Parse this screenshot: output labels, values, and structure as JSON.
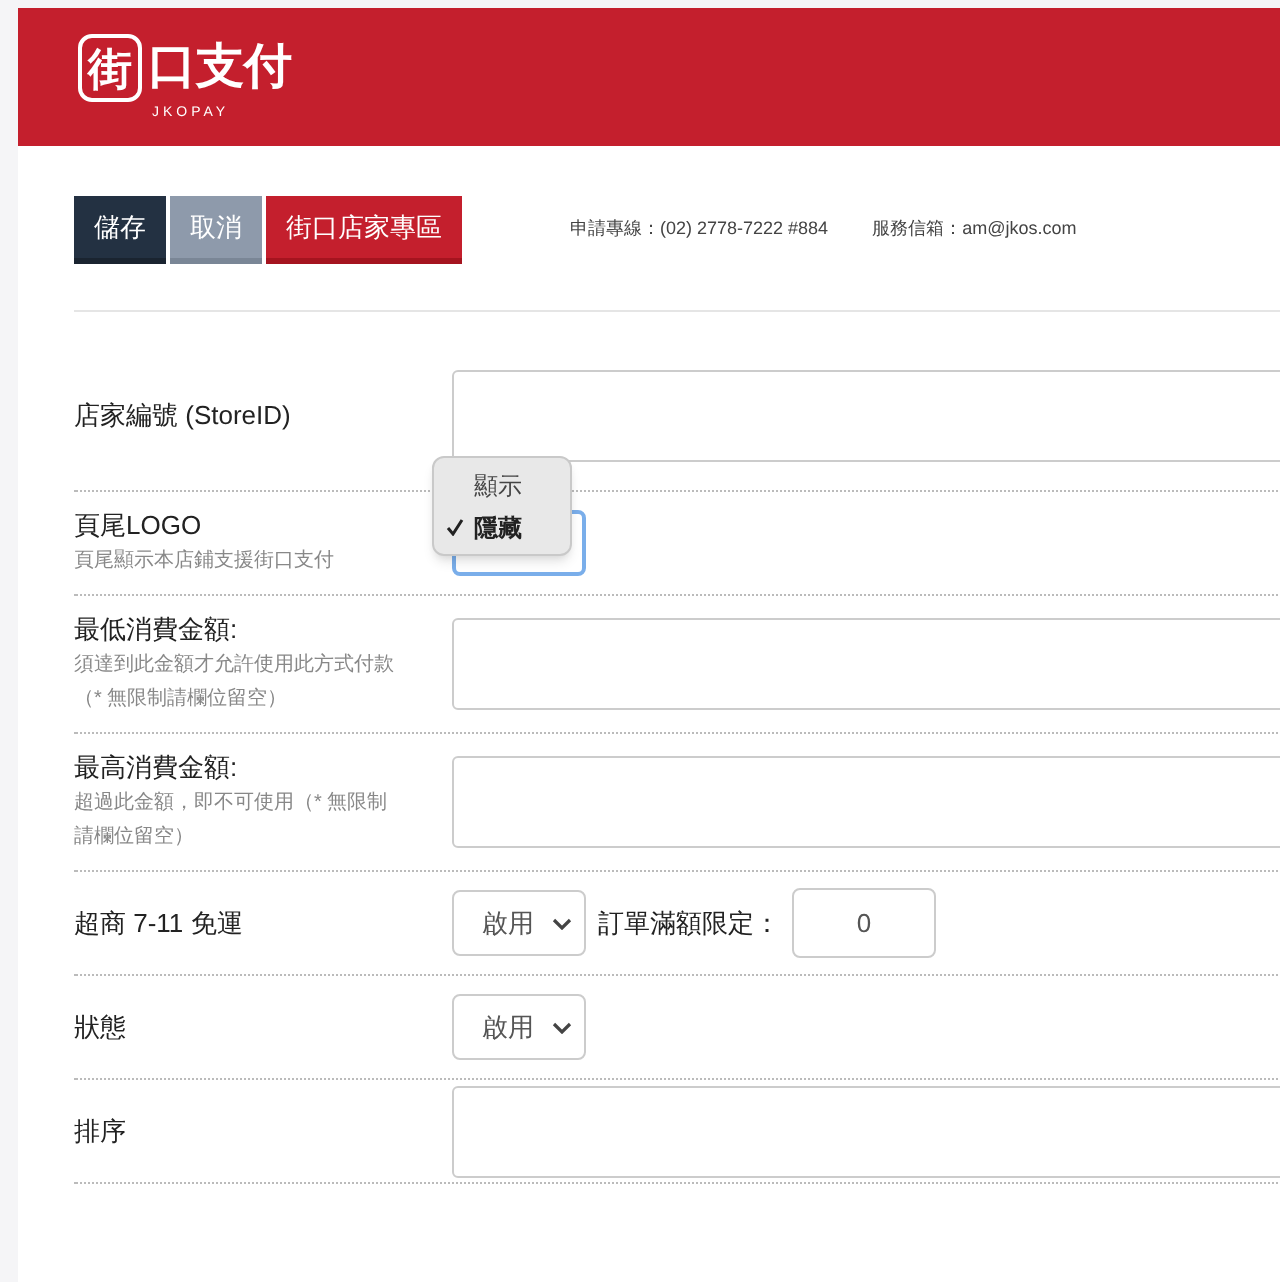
{
  "header": {
    "logo_mark": "街",
    "logo_text": "口支付",
    "logo_subtitle": "JKOPAY"
  },
  "toolbar": {
    "buttons": [
      {
        "label": "儲存",
        "kind": "save"
      },
      {
        "label": "取消",
        "kind": "cancel"
      },
      {
        "label": "街口店家專區",
        "kind": "brand"
      }
    ],
    "contact_phone": "申請專線：(02) 2778-7222 #884",
    "contact_email": "服務信箱：am@jkos.com"
  },
  "form": [
    {
      "kind": "input",
      "label": "店家編號 (StoreID)"
    },
    {
      "kind": "menu",
      "label": "頁尾LOGO",
      "hints": [
        "頁尾顯示本店鋪支援街口支付"
      ],
      "menu": [
        {
          "label": "顯示",
          "selected": false
        },
        {
          "label": "隱藏",
          "selected": true
        }
      ]
    },
    {
      "kind": "input",
      "label": "最低消費金額:",
      "hints": [
        "須達到此金額才允許使用此方式付款",
        "（* 無限制請欄位留空）"
      ]
    },
    {
      "kind": "input",
      "label": "最高消費金額:",
      "hints": [
        "超過此金額，即不可使用（* 無限制請欄位留空）"
      ]
    },
    {
      "kind": "select",
      "label": "超商 7-11 免運",
      "value": "啟用",
      "extra_label": "訂單滿額限定：",
      "extra_value": "0"
    },
    {
      "kind": "select",
      "label": "狀態",
      "value": "啟用"
    },
    {
      "kind": "input",
      "label": "排序"
    }
  ]
}
